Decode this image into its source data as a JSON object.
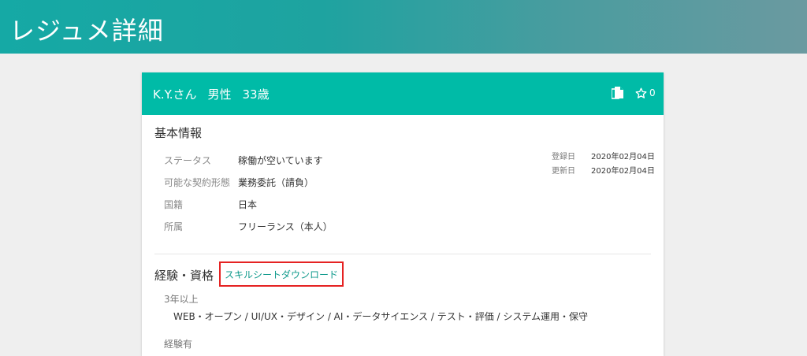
{
  "page": {
    "title": "レジュメ詳細"
  },
  "card": {
    "initials": "K.Y.さん",
    "gender": "男性",
    "age": "33歳",
    "favorite_count": "0"
  },
  "basic": {
    "title": "基本情報",
    "rows": [
      {
        "label": "ステータス",
        "value": "稼働が空いています"
      },
      {
        "label": "可能な契約形態",
        "value": "業務委託（請負）"
      },
      {
        "label": "国籍",
        "value": "日本"
      },
      {
        "label": "所属",
        "value": "フリーランス（本人）"
      }
    ],
    "dates": [
      {
        "label": "登録日",
        "value": "2020年02月04日"
      },
      {
        "label": "更新日",
        "value": "2020年02月04日"
      }
    ]
  },
  "experience": {
    "title": "経験・資格",
    "download_label": "スキルシートダウンロード",
    "groups": [
      {
        "label": "3年以上",
        "value": "WEB・オープン / UI/UX・デザイン / AI・データサイエンス / テスト・評価 / システム運用・保守"
      },
      {
        "label": "経験有",
        "value": ""
      }
    ]
  },
  "colors": {
    "header_teal": "#00bba7",
    "link_teal": "#109a8c",
    "highlight_red": "#e52222"
  }
}
